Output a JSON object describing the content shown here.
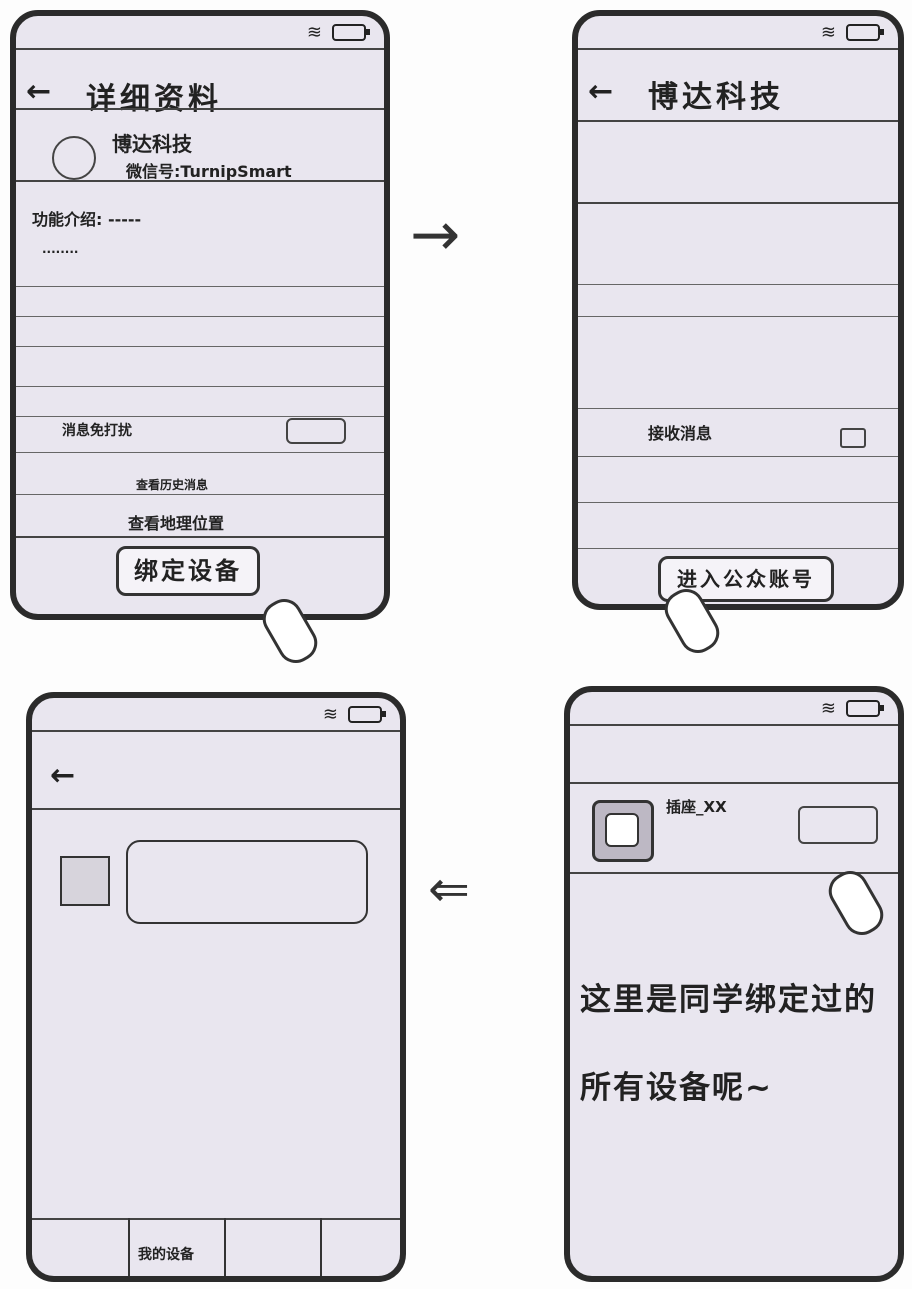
{
  "screen1": {
    "title": "详细资料",
    "account_name": "博达科技",
    "wechat_id": "微信号:TurnipSmart",
    "intro_label": "功能介绍: -----",
    "intro_more": "........",
    "dnd_label": "消息免打扰",
    "history_label": "查看历史消息",
    "location_label": "查看地理位置",
    "bind_button": "绑定设备"
  },
  "screen2": {
    "title": "博达科技",
    "receive_label": "接收消息",
    "enter_button": "进入公众账号"
  },
  "screen3": {
    "tab_my_devices": "我的设备"
  },
  "screen4": {
    "device_name": "插座_XX",
    "caption_line1": "这里是同学绑定过的",
    "caption_line2": "所有设备呢~"
  },
  "icons": {
    "back": "←",
    "wifi": "≋",
    "arrow_right": "→",
    "arrow_left": "⇐"
  }
}
